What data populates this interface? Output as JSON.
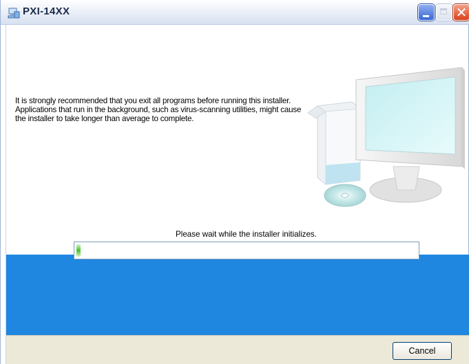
{
  "window": {
    "title": "PXI-14XX",
    "icon": "installer-icon",
    "controls": [
      "minimize-icon",
      "maximize-icon",
      "close-icon"
    ]
  },
  "main": {
    "message": "It is strongly recommended that you exit all programs before running this installer. Applications that run in the background, such as virus-scanning utilities, might cause the installer to take longer than average to complete.",
    "status": "Please wait while the installer initializes.",
    "progress": 0.01
  },
  "footer": {
    "cancel_label": "Cancel"
  },
  "colors": {
    "band": "#1f87e0",
    "progress_fill": "#49c12a",
    "close_button": "#d8401b"
  }
}
